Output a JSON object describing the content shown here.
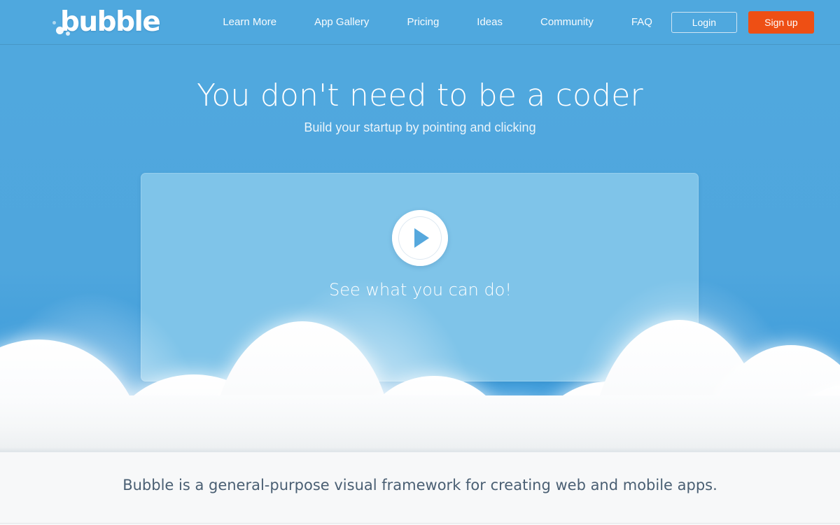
{
  "header": {
    "logo": {
      "text": "bubble",
      "icon": "bubble-logo-icon"
    },
    "nav": [
      {
        "label": "Learn More"
      },
      {
        "label": "App Gallery"
      },
      {
        "label": "Pricing"
      },
      {
        "label": "Ideas"
      },
      {
        "label": "Community"
      },
      {
        "label": "FAQ"
      }
    ],
    "login_label": "Login",
    "signup_label": "Sign up",
    "colors": {
      "background": "#4fa8de",
      "signup_background": "#ee4f14",
      "login_border": "#cfe5f4",
      "text": "#ffffff"
    }
  },
  "hero": {
    "headline": "You don't need to be a coder",
    "subhead": "Build your startup by pointing and clicking",
    "background": "#4fa6dd",
    "video": {
      "caption": "See what you can do!",
      "play_icon": "play-triangle-icon",
      "panel_background": "#7fc4e9"
    }
  },
  "bottom": {
    "tagline": "Bubble is a general-purpose visual framework for creating web and mobile apps.",
    "background": "#f7f8f9",
    "text_color": "#4a5f73"
  }
}
